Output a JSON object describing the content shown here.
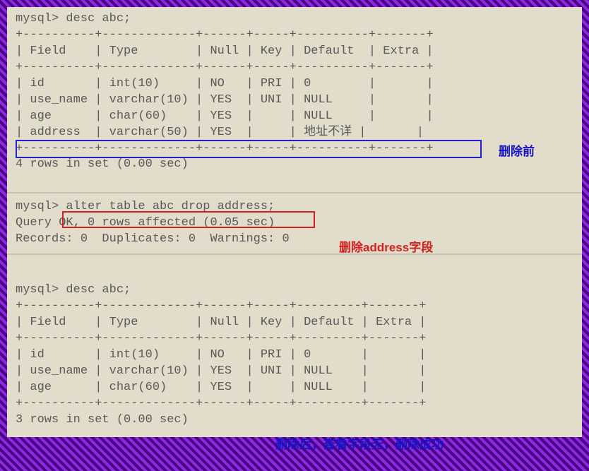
{
  "section1": {
    "prompt": "mysql> desc abc;",
    "border_top": "+----------+-------------+------+-----+----------+-------+",
    "header": "| Field    | Type        | Null | Key | Default  | Extra |",
    "border_mid": "+----------+-------------+------+-----+----------+-------+",
    "rows": [
      "| id       | int(10)     | NO   | PRI | 0        |       |",
      "| use_name | varchar(10) | YES  | UNI | NULL     |       |",
      "| age      | char(60)    | YES  |     | NULL     |       |",
      "| address  | varchar(50) | YES  |     | 地址不详 |       |"
    ],
    "border_bot": "+----------+-------------+------+-----+----------+-------+",
    "result": "4 rows in set (0.00 sec)"
  },
  "section2": {
    "line1": "mysql> alter table abc drop address;",
    "line2": "Query OK, 0 rows affected (0.05 sec)",
    "line3": "Records: 0  Duplicates: 0  Warnings: 0"
  },
  "section3": {
    "prompt": "mysql> desc abc;",
    "border_top": "+----------+-------------+------+-----+---------+-------+",
    "header": "| Field    | Type        | Null | Key | Default | Extra |",
    "border_mid": "+----------+-------------+------+-----+---------+-------+",
    "rows": [
      "| id       | int(10)     | NO   | PRI | 0       |       |",
      "| use_name | varchar(10) | YES  | UNI | NULL    |       |",
      "| age      | char(60)    | YES  |     | NULL    |       |"
    ],
    "border_bot": "+----------+-------------+------+-----+---------+-------+",
    "result": "3 rows in set (0.00 sec)"
  },
  "annotations": {
    "before_delete": "删除前",
    "delete_field": "删除address字段",
    "after_delete": "删除后，查看字段无，删除成功"
  }
}
